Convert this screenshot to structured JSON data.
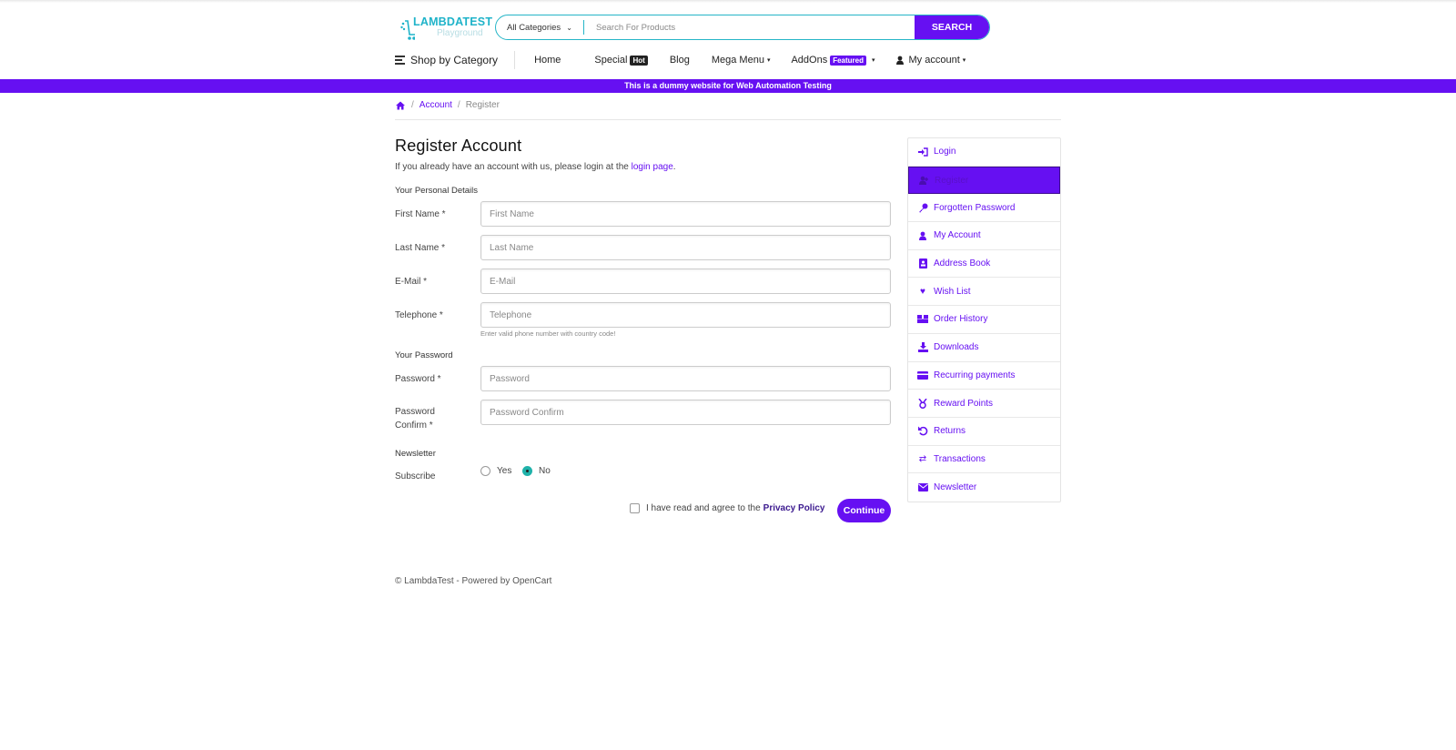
{
  "header": {
    "logo": {
      "brand": "LAMBDATEST",
      "sub": "Playground"
    },
    "search": {
      "category": "All Categories",
      "placeholder": "Search For Products",
      "button": "SEARCH"
    },
    "nav": {
      "shop_by_category": "Shop by Category",
      "items": [
        {
          "label": "Home"
        },
        {
          "label": "Special",
          "badge": "Hot"
        },
        {
          "label": "Blog"
        },
        {
          "label": "Mega Menu"
        },
        {
          "label": "AddOns",
          "badge": "Featured"
        },
        {
          "label": "My account"
        }
      ]
    },
    "banner": "This is a dummy website for Web Automation Testing"
  },
  "breadcrumb": {
    "home": "home-icon",
    "account": "Account",
    "current": "Register"
  },
  "page": {
    "title": "Register Account",
    "intro": "If you already have an account with us, please login at the ",
    "intro_link": "login page",
    "intro_end": "."
  },
  "form": {
    "personal_legend": "Your Personal Details",
    "fields": {
      "firstname": {
        "label": "First Name *",
        "placeholder": "First Name",
        "value": ""
      },
      "lastname": {
        "label": "Last Name *",
        "placeholder": "Last Name",
        "value": ""
      },
      "email": {
        "label": "E-Mail *",
        "placeholder": "E-Mail",
        "value": ""
      },
      "telephone": {
        "label": "Telephone *",
        "placeholder": "Telephone",
        "value": "",
        "help": "Enter valid phone number with country code!"
      },
      "password": {
        "label": "Password *",
        "placeholder": "Password",
        "value": ""
      },
      "confirm_l1": "Password",
      "confirm_l2": "Confirm *",
      "confirm": {
        "placeholder": "Password Confirm",
        "value": ""
      }
    },
    "password_legend": "Your Password",
    "newsletter_legend": "Newsletter",
    "subscribe": {
      "label": "Subscribe",
      "options": [
        "Yes",
        "No"
      ],
      "selected": "No"
    },
    "agree": {
      "text": "I have read and agree to the",
      "link": "Privacy Policy",
      "checked": false
    },
    "continue": "Continue"
  },
  "sidebar": {
    "active": "Register",
    "items": [
      {
        "label": "Login",
        "icon": "sign-in-icon"
      },
      {
        "label": "Register",
        "icon": "user-plus-icon"
      },
      {
        "label": "Forgotten Password",
        "icon": "key-icon"
      },
      {
        "label": "My Account",
        "icon": "user-icon"
      },
      {
        "label": "Address Book",
        "icon": "address-book-icon"
      },
      {
        "label": "Wish List",
        "icon": "heart-icon"
      },
      {
        "label": "Order History",
        "icon": "order-history-icon"
      },
      {
        "label": "Downloads",
        "icon": "download-icon"
      },
      {
        "label": "Recurring payments",
        "icon": "credit-card-icon"
      },
      {
        "label": "Reward Points",
        "icon": "medal-icon"
      },
      {
        "label": "Returns",
        "icon": "undo-icon"
      },
      {
        "label": "Transactions",
        "icon": "exchange-icon"
      },
      {
        "label": "Newsletter",
        "icon": "envelope-icon"
      }
    ]
  },
  "footer": "© LambdaTest - Powered by OpenCart",
  "colors": {
    "accent": "#6610f2",
    "teal": "#25b5c7"
  }
}
